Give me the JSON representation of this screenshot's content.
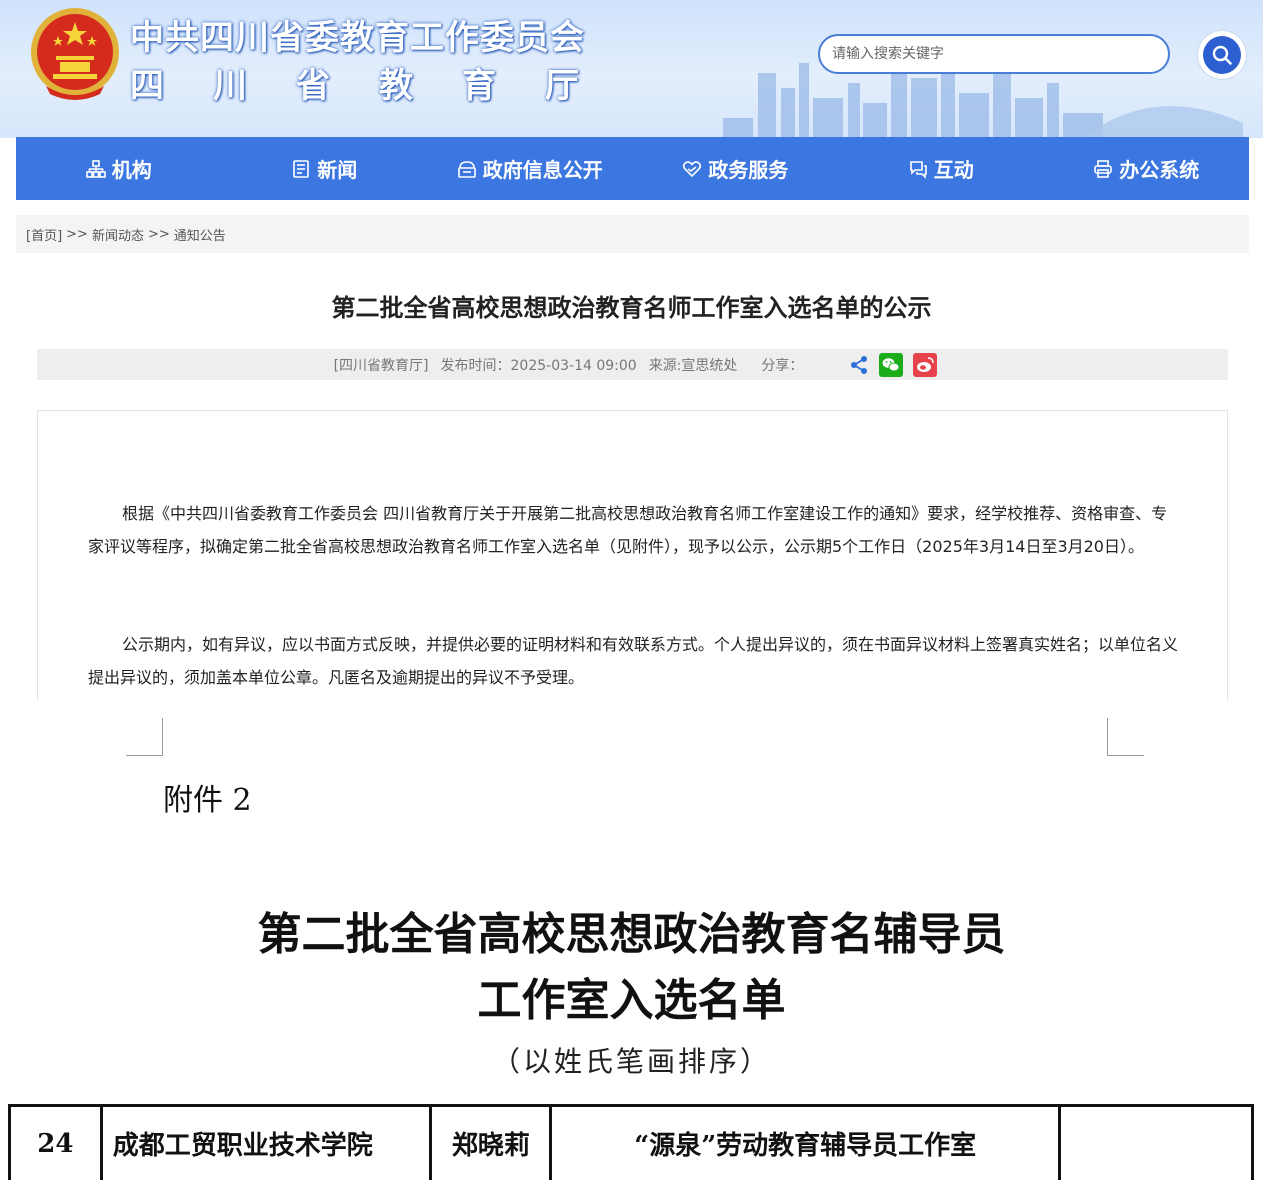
{
  "header": {
    "title_line1": "中共四川省委教育工作委员会",
    "title_line2": "四川省教育厅",
    "search_placeholder": "请输入搜索关键字"
  },
  "nav": {
    "items": [
      {
        "label": "机构",
        "icon": "org-chart-icon"
      },
      {
        "label": "新闻",
        "icon": "news-icon"
      },
      {
        "label": "政府信息公开",
        "icon": "info-disclosure-icon"
      },
      {
        "label": "政务服务",
        "icon": "service-heart-icon"
      },
      {
        "label": "互动",
        "icon": "chat-icon"
      },
      {
        "label": "办公系统",
        "icon": "printer-icon"
      }
    ]
  },
  "breadcrumb": {
    "home": "[首页]",
    "sep": ">>",
    "level1": "新闻动态",
    "level2": "通知公告"
  },
  "article": {
    "title": "第二批全省高校思想政治教育名师工作室入选名单的公示",
    "publisher": "[四川省教育厅]",
    "publish_label": "发布时间：",
    "publish_time": "2025-03-14 09:00",
    "source": "来源:宣思统处",
    "share_label": "分享：",
    "paragraph1": "根据《中共四川省委教育工作委员会 四川省教育厅关于开展第二批高校思想政治教育名师工作室建设工作的通知》要求，经学校推荐、资格审查、专家评议等程序，拟确定第二批全省高校思想政治教育名师工作室入选名单（见附件），现予以公示，公示期5个工作日（2025年3月14日至3月20日）。",
    "paragraph2": "公示期内，如有异议，应以书面方式反映，并提供必要的证明材料和有效联系方式。个人提出异议的，须在书面异议材料上签署真实姓名；以单位名义提出异议的，须加盖本单位公章。凡匿名及逾期提出的异议不予受理。"
  },
  "document": {
    "attachment_label": "附件 2",
    "title_line1": "第二批全省高校思想政治教育名辅导员",
    "title_line2": "工作室入选名单",
    "subtitle": "（以姓氏笔画排序）",
    "rows": [
      {
        "no": "24",
        "school": "成都工贸职业技术学院",
        "name": "郑晓莉",
        "studio": "“源泉”劳动教育辅导员工作室",
        "note": ""
      }
    ]
  },
  "colors": {
    "nav_bg": "#3b76e1",
    "header_bg": "#d6e6fb",
    "search_btn": "#2d5fd1",
    "wechat": "#1aad19",
    "weibo": "#e6424b",
    "share": "#2d6fd8"
  }
}
